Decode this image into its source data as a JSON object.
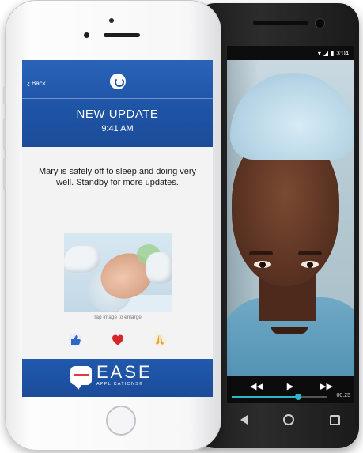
{
  "android": {
    "status_time": "3:04",
    "video": {
      "time_label": "00:25",
      "progress": 0.7
    }
  },
  "ios_app": {
    "nav": {
      "back_label": "Back"
    },
    "update": {
      "title": "NEW UPDATE",
      "time": "9:41 AM",
      "message": "Mary is safely off to sleep and doing very well. Standby for more updates."
    },
    "photo_hint": "Tap image to enlarge",
    "reactions": [
      {
        "name": "thumbs-up",
        "color": "#2f67c8"
      },
      {
        "name": "heart",
        "color": "#d6262a"
      },
      {
        "name": "praying-hands",
        "color": "#e0a336"
      }
    ],
    "brand": {
      "name": "EASE",
      "subtitle": "APPLICATIONS®",
      "color": "#1f55a7"
    }
  }
}
